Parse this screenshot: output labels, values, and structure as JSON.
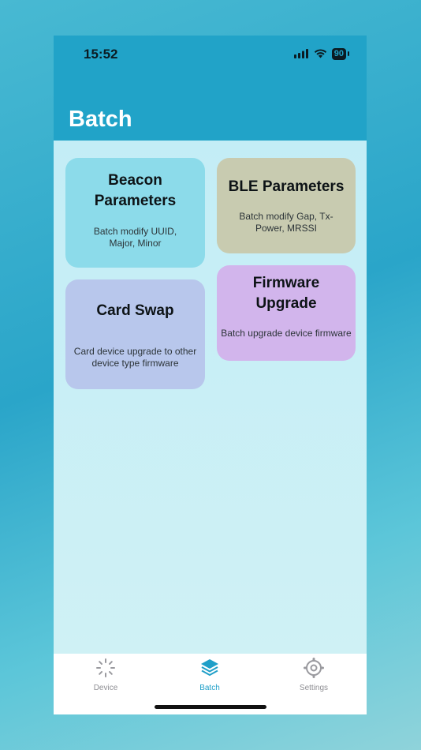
{
  "status_bar": {
    "time": "15:52",
    "battery": "90"
  },
  "header": {
    "title": "Batch"
  },
  "cards": [
    {
      "title_line1": "Beacon",
      "title_line2": "Parameters",
      "desc_line1": "Batch modify UUID,",
      "desc_line2": "Major, Minor"
    },
    {
      "title_line1": "BLE Parameters",
      "desc_line1": "Batch modify Gap, Tx-",
      "desc_line2": "Power, MRSSI"
    },
    {
      "title_line1": "Card Swap",
      "desc_line1": "Card device upgrade to other",
      "desc_line2": "device type firmware"
    },
    {
      "title_line1": "Firmware",
      "title_line2": "Upgrade",
      "desc_line1": "Batch upgrade device firmware"
    }
  ],
  "tabbar": {
    "tabs": [
      {
        "label": "Device",
        "icon": "device-spinner-icon",
        "active": false
      },
      {
        "label": "Batch",
        "icon": "layers-icon",
        "active": true
      },
      {
        "label": "Settings",
        "icon": "gear-icon",
        "active": false
      }
    ]
  },
  "colors": {
    "accent": "#21a3c8",
    "header_bg": "#21a3c8",
    "content_bg": "#c9eef5"
  }
}
